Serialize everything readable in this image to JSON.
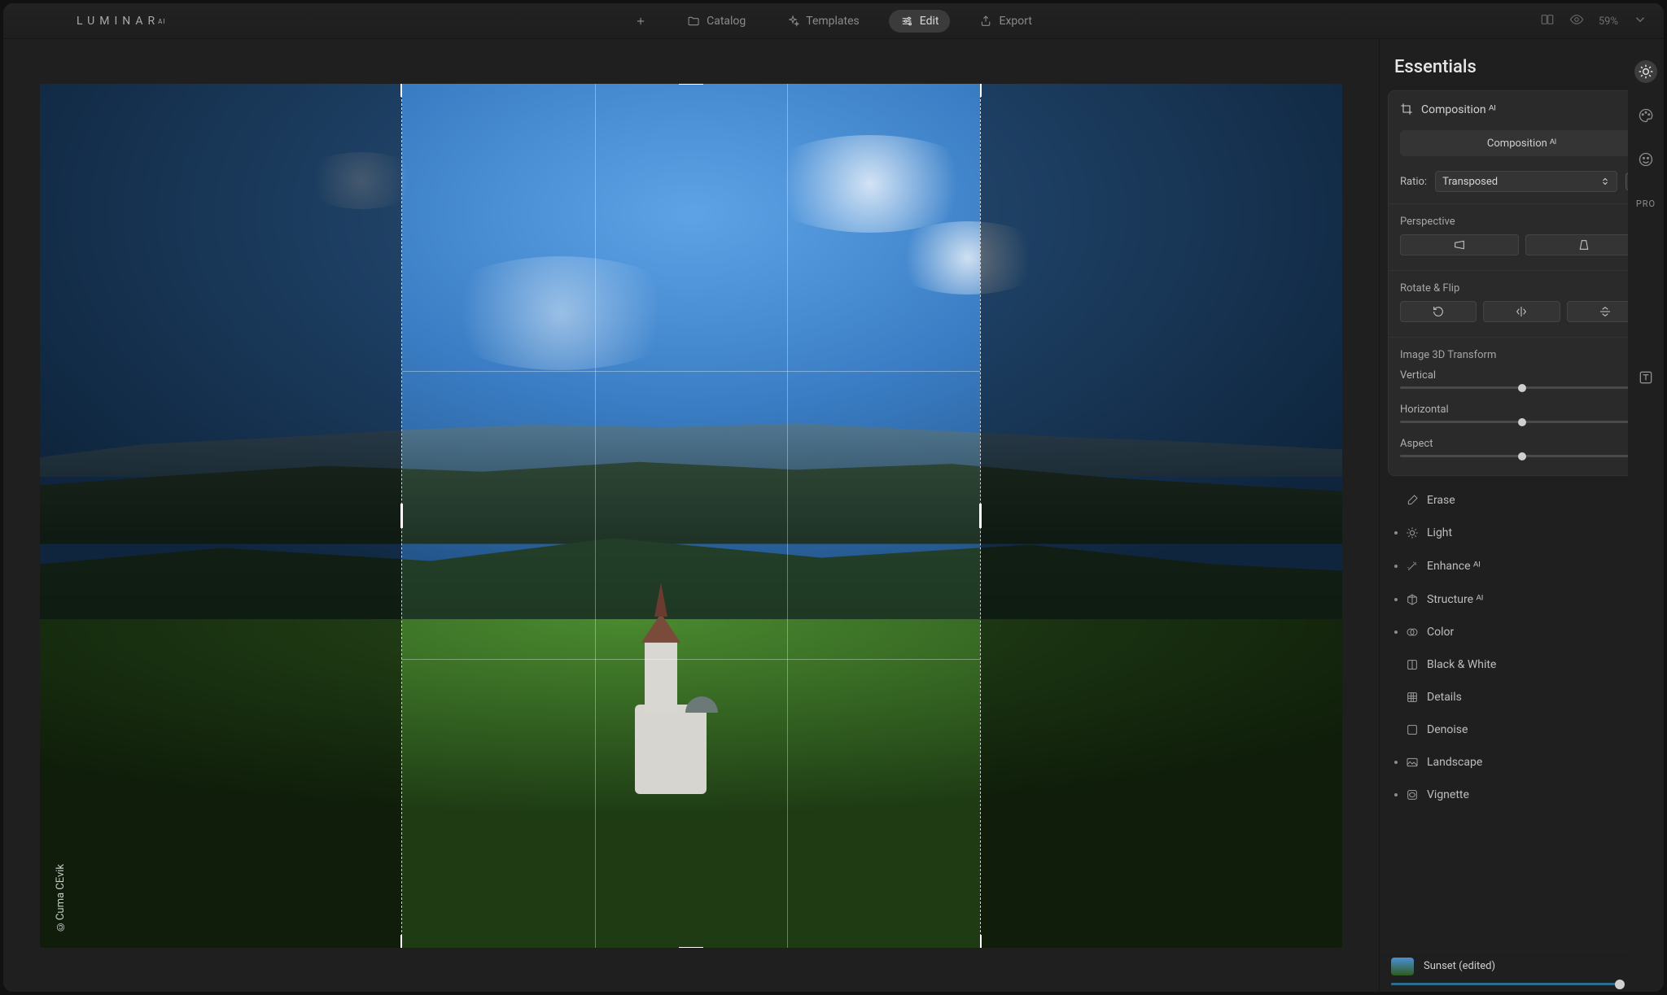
{
  "app": {
    "name": "LUMINAR",
    "suffix": "AI"
  },
  "nav": {
    "catalog": "Catalog",
    "templates": "Templates",
    "edit": "Edit",
    "export": "Export"
  },
  "titlebar": {
    "zoom": "59%"
  },
  "panel": {
    "title": "Essentials",
    "composition": {
      "label": "Composition ᴬᴵ",
      "chip": "Composition ᴬᴵ",
      "ratio_label": "Ratio:",
      "ratio_value": "Transposed",
      "perspective_label": "Perspective",
      "rotate_flip_label": "Rotate & Flip",
      "transform_label": "Image 3D Transform",
      "sliders": {
        "vertical": {
          "label": "Vertical",
          "value": "0"
        },
        "horizontal": {
          "label": "Horizontal",
          "value": "0"
        },
        "aspect": {
          "label": "Aspect",
          "value": "0"
        }
      }
    },
    "tools": {
      "erase": "Erase",
      "light": "Light",
      "enhance": "Enhance ᴬᴵ",
      "structure": "Structure ᴬᴵ",
      "color": "Color",
      "bw": "Black & White",
      "details": "Details",
      "denoise": "Denoise",
      "landscape": "Landscape",
      "vignette": "Vignette"
    }
  },
  "preset": {
    "name": "Sunset (edited)"
  },
  "rail": {
    "pro": "PRO"
  },
  "credit": "©Cuma CEvik"
}
